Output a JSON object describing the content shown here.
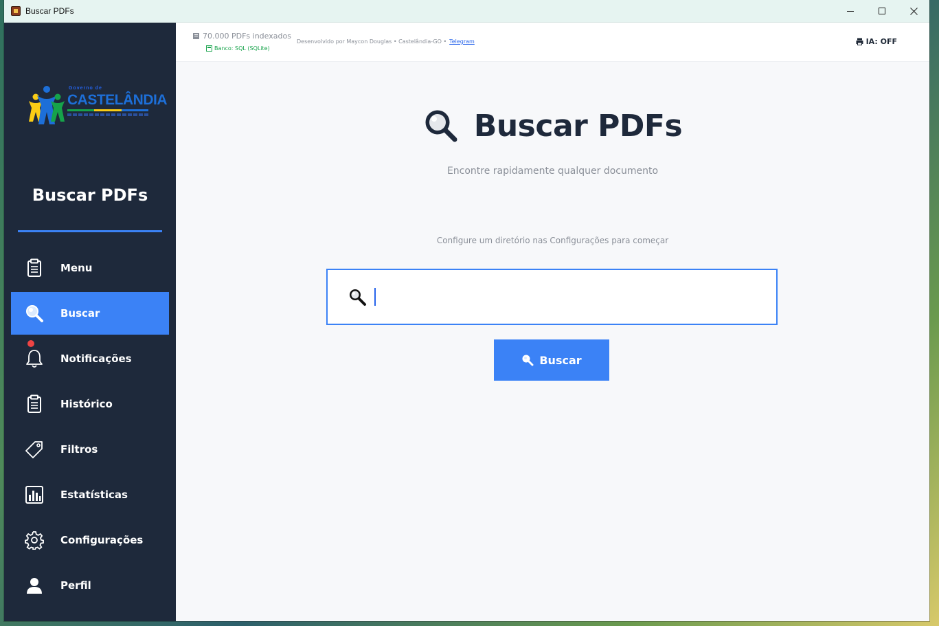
{
  "window": {
    "title": "Buscar PDFs",
    "minimize": "—",
    "maximize": "☐",
    "close": "✕"
  },
  "sidebar": {
    "logo": {
      "top_text": "Governo de",
      "main_text": "CASTELÂNDIA"
    },
    "title": "Buscar PDFs",
    "items": [
      {
        "label": "Menu",
        "icon": "clipboard-icon"
      },
      {
        "label": "Buscar",
        "icon": "search-icon",
        "active": true
      },
      {
        "label": "Notificações",
        "icon": "bell-icon"
      },
      {
        "label": "Histórico",
        "icon": "clipboard-icon"
      },
      {
        "label": "Filtros",
        "icon": "tag-icon"
      },
      {
        "label": "Estatísticas",
        "icon": "bar-chart-icon"
      },
      {
        "label": "Configurações",
        "icon": "gear-icon"
      },
      {
        "label": "Perfil",
        "icon": "user-icon"
      }
    ]
  },
  "topbar": {
    "indexed": "70.000 PDFs indexados",
    "database": "Banco: SQL (SQLite)",
    "credit": "Desenvolvido por Maycon Douglas • Castelândia-GO •",
    "credit_link": "Telegram",
    "ia_status": "IA: OFF"
  },
  "main": {
    "title": "Buscar PDFs",
    "subtitle": "Encontre rapidamente qualquer documento",
    "hint": "Configure um diretório nas Configurações para começar",
    "search": {
      "value": "",
      "placeholder": ""
    },
    "search_button": "Buscar"
  },
  "colors": {
    "sidebar": "#1e293b",
    "accent": "#3b82f6",
    "text_dark": "#1e293b",
    "muted": "#8a8f98",
    "badge": "#ef4444"
  }
}
